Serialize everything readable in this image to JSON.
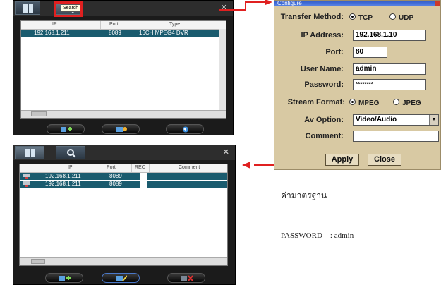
{
  "search_panel": {
    "tooltip": "Search",
    "columns": [
      "IP",
      "Port",
      "Type"
    ],
    "rows": [
      {
        "ip": "192.168.1.211",
        "port": "8089",
        "type": "16CH MPEG4 DVR"
      }
    ]
  },
  "device_panel": {
    "columns": [
      "IP",
      "Port",
      "REC",
      "Comment"
    ],
    "rows": [
      {
        "ip": "192.168.1.211",
        "port": "8089"
      },
      {
        "ip": "192.168.1.211",
        "port": "8089"
      }
    ]
  },
  "dialog": {
    "title": "Configure",
    "transfer_label": "Transfer Method:",
    "tcp": "TCP",
    "udp": "UDP",
    "ip_label": "IP Address:",
    "ip_value": "192.168.1.10",
    "port_label": "Port:",
    "port_value": "80",
    "user_label": "User Name:",
    "user_value": "admin",
    "pass_label": "Password:",
    "pass_value": "********",
    "stream_label": "Stream Format:",
    "mpeg": "MPEG",
    "jpeg": "JPEG",
    "av_label": "Av Option:",
    "av_value": "Video/Audio",
    "comment_label": "Comment:",
    "comment_value": "",
    "apply": "Apply",
    "close": "Close"
  },
  "notes": {
    "thai_heading": "ค่ามาตรฐาน",
    "password_line": "PASSWORD    : admin"
  }
}
